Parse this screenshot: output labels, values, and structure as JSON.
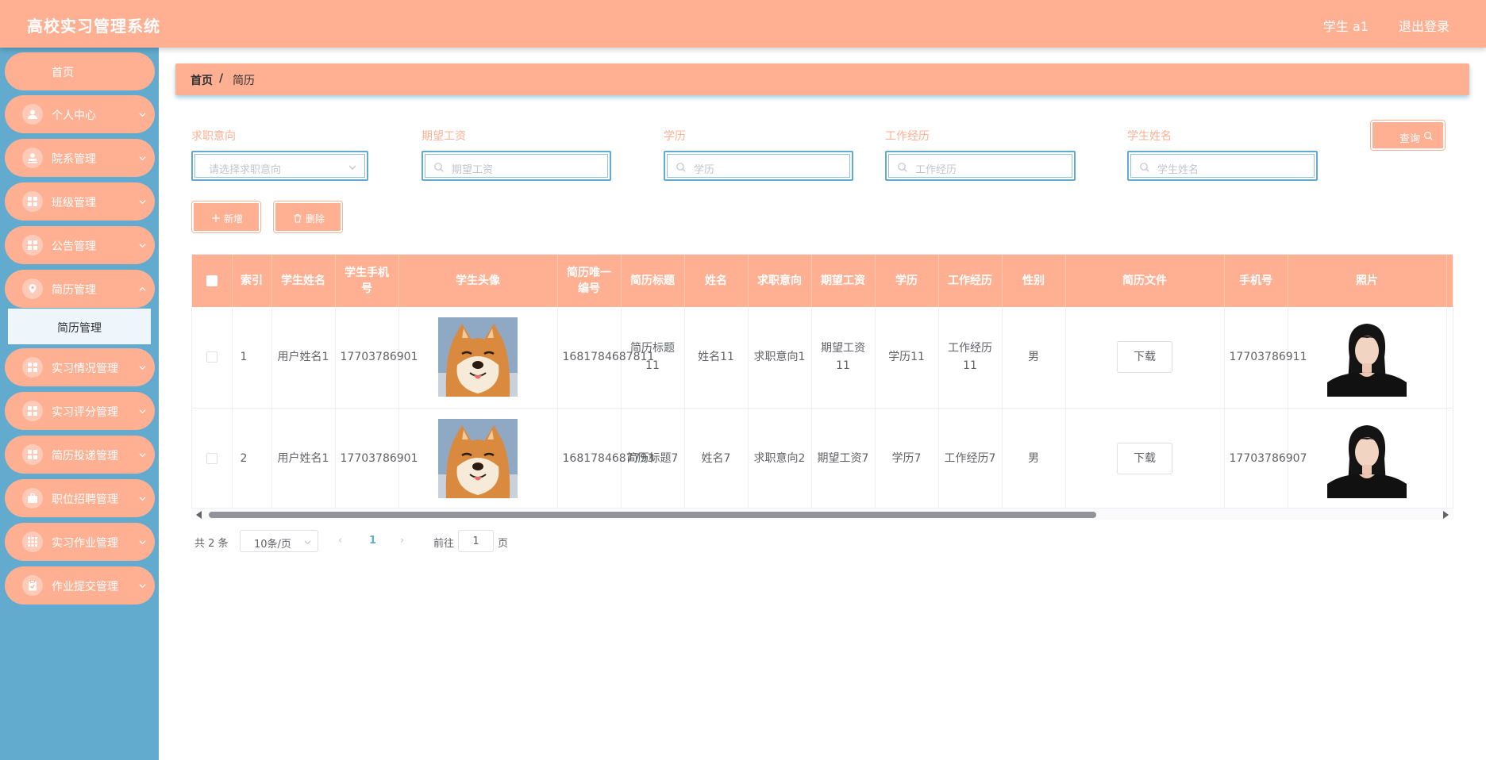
{
  "header": {
    "title": "高校实习管理系统",
    "user": "学生 a1",
    "logout": "退出登录"
  },
  "colors": {
    "accent": "#ffb093",
    "sidebar": "#62abce",
    "page_active": "#62abce"
  },
  "sidebar": {
    "home": "首页",
    "items": [
      {
        "label": "个人中心",
        "icon": "user-icon"
      },
      {
        "label": "院系管理",
        "icon": "stamp-icon"
      },
      {
        "label": "班级管理",
        "icon": "grid-icon"
      },
      {
        "label": "公告管理",
        "icon": "grid-icon"
      },
      {
        "label": "简历管理",
        "icon": "location-icon"
      },
      {
        "label": "实习情况管理",
        "icon": "grid-icon"
      },
      {
        "label": "实习评分管理",
        "icon": "grid-icon"
      },
      {
        "label": "简历投递管理",
        "icon": "grid-icon"
      },
      {
        "label": "职位招聘管理",
        "icon": "briefcase-icon"
      },
      {
        "label": "实习作业管理",
        "icon": "apps-icon"
      },
      {
        "label": "作业提交管理",
        "icon": "clipboard-icon"
      }
    ],
    "sub_item": "简历管理"
  },
  "breadcrumb": {
    "home": "首页",
    "sep": "/",
    "current": "简历"
  },
  "filters": {
    "intent": {
      "label": "求职意向",
      "placeholder": "请选择求职意向"
    },
    "salary": {
      "label": "期望工资",
      "placeholder": "期望工资"
    },
    "education": {
      "label": "学历",
      "placeholder": "学历"
    },
    "experience": {
      "label": "工作经历",
      "placeholder": "工作经历"
    },
    "student_name": {
      "label": "学生姓名",
      "placeholder": "学生姓名"
    },
    "query": "查询"
  },
  "actions": {
    "add": "新增",
    "delete": "删除"
  },
  "table": {
    "headers": [
      "索引",
      "学生姓名",
      "学生手机号",
      "学生头像",
      "简历唯一编号",
      "简历标题",
      "姓名",
      "求职意向",
      "期望工资",
      "学历",
      "工作经历",
      "性别",
      "简历文件",
      "手机号",
      "照片"
    ],
    "download_label": "下载",
    "rows": [
      {
        "index": "1",
        "student_name": "用户姓名1",
        "student_phone": "17703786901",
        "resume_no": "1681784687811",
        "title": "简历标题11",
        "name": "姓名11",
        "intent": "求职意向1",
        "salary": "期望工资11",
        "education": "学历11",
        "experience": "工作经历11",
        "gender": "男",
        "phone": "17703786911"
      },
      {
        "index": "2",
        "student_name": "用户姓名1",
        "student_phone": "17703786901",
        "resume_no": "1681784687793",
        "title": "简历标题7",
        "name": "姓名7",
        "intent": "求职意向2",
        "salary": "期望工资7",
        "education": "学历7",
        "experience": "工作经历7",
        "gender": "男",
        "phone": "17703786907"
      }
    ]
  },
  "pagination": {
    "total": "共 2 条",
    "page_size": "10条/页",
    "prev": "‹",
    "current": "1",
    "next": "›",
    "goto": "前往",
    "goto_value": "1",
    "page": "页"
  }
}
